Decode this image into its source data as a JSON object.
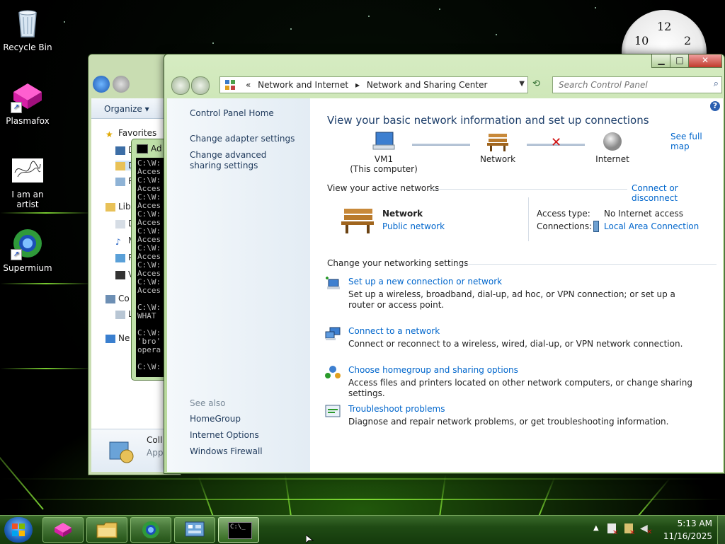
{
  "desktop": {
    "icons": [
      {
        "label": "Recycle Bin"
      },
      {
        "label": "Plasmafox"
      },
      {
        "label": "I am an artist"
      },
      {
        "label": "Supermium"
      }
    ],
    "clock_numbers": [
      "10",
      "12",
      "2"
    ]
  },
  "explorer": {
    "organize_label": "Organize",
    "favorites_label": "Favorites",
    "tree": [
      "D",
      "D",
      "R",
      "Libr",
      "D",
      "M",
      "P",
      "V",
      "Co",
      "L",
      "Ne"
    ],
    "details_title": "Coll",
    "details_sub": "App"
  },
  "cmd": {
    "title": "Ad",
    "lines": [
      "C:\\W:",
      "Acces",
      "C:\\W:",
      "Acces",
      "C:\\W:",
      "Acces",
      "C:\\W:",
      "Acces",
      "C:\\W:",
      "Acces",
      "C:\\W:",
      "Acces",
      "C:\\W:",
      "Acces",
      "C:\\W:",
      "Acces",
      "",
      "C:\\W:",
      "WHAT",
      "",
      "C:\\W:",
      "'bro'",
      "opera",
      "",
      "C:\\W:"
    ]
  },
  "nsc": {
    "breadcrumb": [
      "«",
      "Network and Internet",
      "▸",
      "Network and Sharing Center"
    ],
    "search_placeholder": "Search Control Panel",
    "left": {
      "home": "Control Panel Home",
      "adapter": "Change adapter settings",
      "advanced": "Change advanced sharing settings",
      "see_also": "See also",
      "homegroup": "HomeGroup",
      "internet_options": "Internet Options",
      "firewall": "Windows Firewall"
    },
    "heading": "View your basic network information and set up connections",
    "see_full_map": "See full map",
    "map": {
      "computer": "VM1",
      "computer_sub": "(This computer)",
      "network": "Network",
      "internet": "Internet"
    },
    "active_networks_label": "View your active networks",
    "connect_disconnect": "Connect or disconnect",
    "active": {
      "name": "Network",
      "type": "Public network",
      "access_type_label": "Access type:",
      "access_type_value": "No Internet access",
      "connections_label": "Connections:",
      "connections_value": "Local Area Connection"
    },
    "change_settings_label": "Change your networking settings",
    "settings": [
      {
        "title": "Set up a new connection or network",
        "desc": "Set up a wireless, broadband, dial-up, ad hoc, or VPN connection; or set up a router or access point."
      },
      {
        "title": "Connect to a network",
        "desc": "Connect or reconnect to a wireless, wired, dial-up, or VPN network connection."
      },
      {
        "title": "Choose homegroup and sharing options",
        "desc": "Access files and printers located on other network computers, or change sharing settings."
      },
      {
        "title": "Troubleshoot problems",
        "desc": "Diagnose and repair network problems, or get troubleshooting information."
      }
    ]
  },
  "taskbar": {
    "time": "5:13 AM",
    "date": "11/16/2025"
  },
  "colors": {
    "link": "#0066cc",
    "window_frame": "#b9d99e",
    "accent_green": "#5fd02a"
  }
}
